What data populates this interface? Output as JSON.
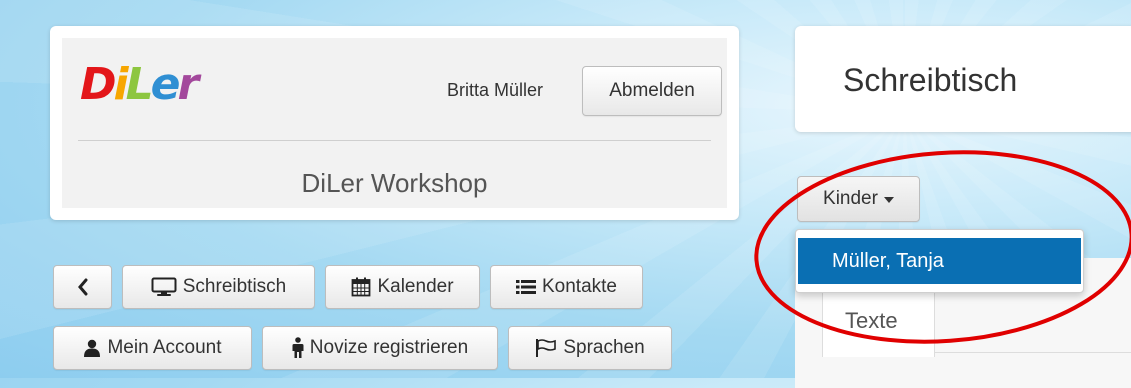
{
  "header": {
    "logo_text": "DiLer",
    "user_name": "Britta Müller",
    "logout_label": "Abmelden",
    "site_title": "DiLer Workshop"
  },
  "nav": {
    "back_icon": "chevron-left-icon",
    "items": [
      {
        "label": "Schreibtisch",
        "icon": "monitor-icon"
      },
      {
        "label": "Kalender",
        "icon": "calendar-icon"
      },
      {
        "label": "Kontakte",
        "icon": "list-icon"
      },
      {
        "label": "Mein Account",
        "icon": "user-icon"
      },
      {
        "label": "Novize registrieren",
        "icon": "person-icon"
      },
      {
        "label": "Sprachen",
        "icon": "flag-icon"
      }
    ]
  },
  "desk": {
    "title": "Schreibtisch",
    "children_dropdown_label": "Kinder",
    "children_options": [
      "Müller, Tanja"
    ],
    "tabs": [
      "Texte"
    ]
  },
  "colors": {
    "accent_blue": "#0a6fb3",
    "highlight_ring": "#e00000",
    "logo_red": "#e3161a",
    "logo_orange": "#f7a600",
    "logo_green": "#8dc63f",
    "logo_blue": "#2f8fd3",
    "logo_purple": "#a3489c"
  }
}
